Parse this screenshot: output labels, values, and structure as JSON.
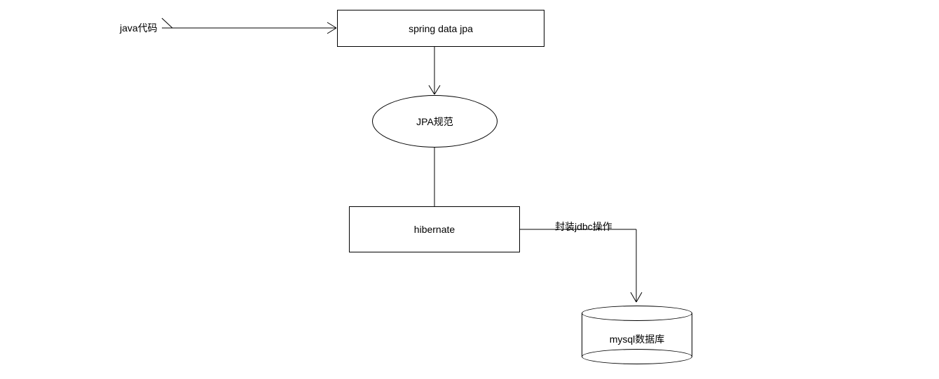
{
  "labels": {
    "java_code": "java代码",
    "jdbc_wrap": "封装jdbc操作"
  },
  "nodes": {
    "spring_data_jpa": "spring data  jpa",
    "jpa_spec": "JPA规范",
    "hibernate": "hibernate",
    "mysql_db": "mysql数据库"
  }
}
